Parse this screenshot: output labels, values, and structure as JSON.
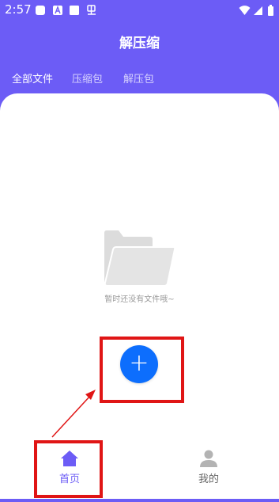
{
  "status_bar": {
    "time": "2:57",
    "icons": [
      "notification-square-icon",
      "a-icon",
      "square-icon",
      "bug-icon",
      "wifi-icon",
      "signal-icon",
      "battery-icon"
    ]
  },
  "header": {
    "title": "解压缩"
  },
  "tabs": [
    {
      "label": "全部文件",
      "active": true
    },
    {
      "label": "压缩包",
      "active": false
    },
    {
      "label": "解压包",
      "active": false
    }
  ],
  "empty_state": {
    "icon": "folder-icon",
    "text": "暂时还没有文件哦~"
  },
  "fab": {
    "icon": "plus-icon",
    "label": "+"
  },
  "bottom_nav": {
    "items": [
      {
        "label": "首页",
        "icon": "home-icon",
        "active": true
      },
      {
        "label": "我的",
        "icon": "person-icon",
        "active": false
      }
    ]
  },
  "colors": {
    "primary": "#6c5cf6",
    "fab": "#0d6efd",
    "annotation": "#e01515",
    "inactive": "#666666",
    "empty": "#dcdcdc"
  }
}
